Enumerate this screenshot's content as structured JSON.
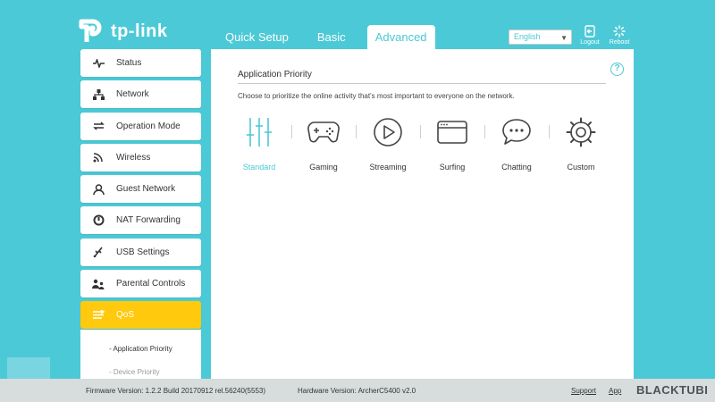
{
  "brand": {
    "logo_text": "tp-link",
    "accent": "#4cc9d6",
    "active_color": "#ffc90e"
  },
  "header": {
    "tabs": [
      {
        "label": "Quick Setup"
      },
      {
        "label": "Basic"
      },
      {
        "label": "Advanced"
      }
    ],
    "language": "English",
    "logout_label": "Logout",
    "reboot_label": "Reboot"
  },
  "sidebar": {
    "items": [
      {
        "label": "Status",
        "icon": "pulse-icon"
      },
      {
        "label": "Network",
        "icon": "network-icon"
      },
      {
        "label": "Operation Mode",
        "icon": "swap-icon"
      },
      {
        "label": "Wireless",
        "icon": "wifi-icon"
      },
      {
        "label": "Guest Network",
        "icon": "guest-icon"
      },
      {
        "label": "NAT Forwarding",
        "icon": "nat-icon"
      },
      {
        "label": "USB Settings",
        "icon": "usb-icon"
      },
      {
        "label": "Parental Controls",
        "icon": "parental-icon"
      },
      {
        "label": "QoS",
        "icon": "qos-icon"
      }
    ],
    "subitems": [
      {
        "label": "- Application Priority"
      },
      {
        "label": "- Device Priority"
      }
    ]
  },
  "main": {
    "title": "Application Priority",
    "description": "Choose to prioritize the online activity that's most important to everyone on the network.",
    "help": "?",
    "options": [
      {
        "label": "Standard",
        "icon": "sliders-icon"
      },
      {
        "label": "Gaming",
        "icon": "gamepad-icon"
      },
      {
        "label": "Streaming",
        "icon": "play-icon"
      },
      {
        "label": "Surfing",
        "icon": "browser-icon"
      },
      {
        "label": "Chatting",
        "icon": "chat-icon"
      },
      {
        "label": "Custom",
        "icon": "gear-icon"
      }
    ],
    "selected": "Standard"
  },
  "footer": {
    "firmware": "Firmware Version: 1.2.2 Build 20170912 rel.56240(5553)",
    "hardware": "Hardware Version: ArcherC5400 v2.0",
    "support": "Support",
    "app": "App",
    "watermark": "BLACKTUBI"
  }
}
